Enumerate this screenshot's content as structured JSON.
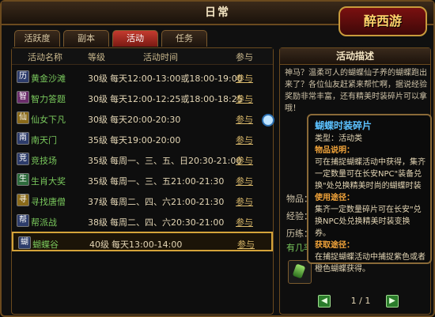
{
  "window": {
    "title": "日常",
    "logo": "醉西游"
  },
  "tabs": [
    "活跃度",
    "副本",
    "活动",
    "任务"
  ],
  "table": {
    "headers": {
      "name": "活动名称",
      "level": "等级",
      "time": "活动时间",
      "join": "参与"
    },
    "rows": [
      {
        "icon": "历",
        "name": "黄金沙滩",
        "level": "30级",
        "time": "每天12:00-13:00或18:00-19:00",
        "join": "参与"
      },
      {
        "icon": "智",
        "name": "智力答题",
        "level": "30级",
        "time": "每天12:00-12:25或18:00-18:25",
        "join": "参与"
      },
      {
        "icon": "仙",
        "name": "仙女下凡",
        "level": "30级",
        "time": "每天20:00-20:30",
        "join": "参与"
      },
      {
        "icon": "南",
        "name": "南天门",
        "level": "35级",
        "time": "每天19:00-20:00",
        "join": "参与"
      },
      {
        "icon": "竞",
        "name": "竞技场",
        "level": "35级",
        "time": "每周一、三、五、日20:30-21:00",
        "join": "参与"
      },
      {
        "icon": "生",
        "name": "生肖大奖",
        "level": "35级",
        "time": "每周一、三、五21:00-21:30",
        "join": "参与"
      },
      {
        "icon": "寻",
        "name": "寻找唐僧",
        "level": "37级",
        "time": "每周二、四、六21:00-21:30",
        "join": "参与"
      },
      {
        "icon": "帮",
        "name": "帮派战",
        "level": "38级",
        "time": "每周二、四、六20:30-21:00",
        "join": "参与"
      },
      {
        "icon": "蝴",
        "name": "蝴蝶谷",
        "level": "40级",
        "time": "每天13:00-14:00",
        "join": "参与"
      }
    ]
  },
  "description": {
    "title": "活动描述",
    "text": "神马？温柔可人的蝴蝶仙子养的蝴蝶跑出来了？各位仙友赶紧来帮忙啊，据说经验奖励非常丰富，还有精美时装碎片可以拿哦！",
    "labels": {
      "item": "物品：",
      "exp": "经验：",
      "history": "历练："
    },
    "reward": "有几率"
  },
  "pager": {
    "prev": "◀",
    "page": "1 / 1",
    "next": "▶"
  },
  "tooltip": {
    "title": "蝴蝶时装碎片",
    "type": "类型：活动类",
    "item_label": "物品说明：",
    "item_desc": "可在捕捉蝴蝶活动中获得，集齐一定数量可在长安NPC\"装备兑换\"处兑换精美时尚的蝴蝶时装",
    "use_label": "使用途径：",
    "use_desc": "集齐一定数量碎片可在长安\"兑换NPC处兑换精美时装变换券。",
    "get_label": "获取途径：",
    "get_desc": "在捕捉蝴蝶活动中捕捉紫色或者橙色蝴蝶获得。"
  }
}
